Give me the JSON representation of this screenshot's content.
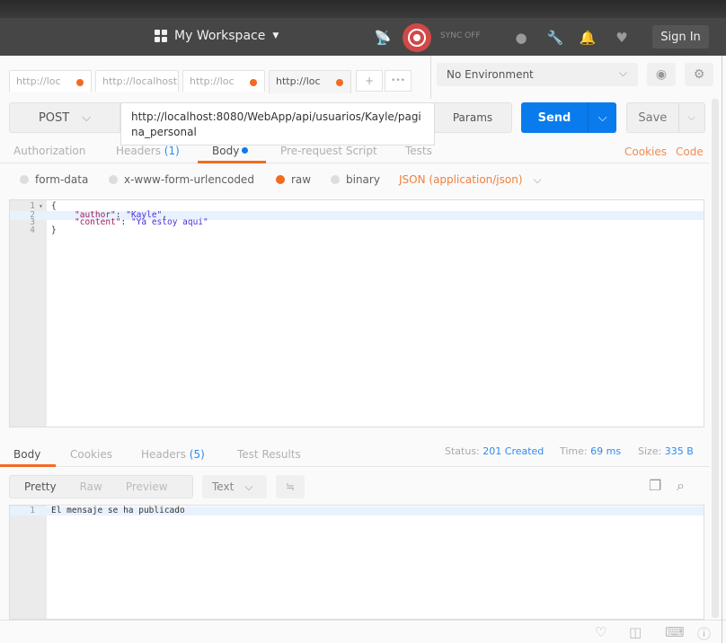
{
  "header": {
    "workspace_label": "My Workspace",
    "sync_status": "SYNC OFF",
    "sign_in_label": "Sign In",
    "icons": [
      "interceptor-icon",
      "sync-icon",
      "globe-icon",
      "wrench-icon",
      "bell-icon",
      "heart-icon"
    ]
  },
  "request_tabs": [
    {
      "label": "http://loc",
      "unsaved": true
    },
    {
      "label": "http://localhost",
      "unsaved": false
    },
    {
      "label": "http://loc",
      "unsaved": true
    },
    {
      "label": "http://loc",
      "unsaved": true,
      "active": true
    }
  ],
  "tab_actions": {
    "new_tab": "+",
    "more": "•••"
  },
  "environment": {
    "selected": "No Environment"
  },
  "request": {
    "method": "POST",
    "url": "http://localhost:8080/WebApp/api/usuarios/Kayle/pagina_personal",
    "url_line1": "http://localhost:8080/WebApp/api/usuarios/Kayle/pagi",
    "url_line2": "na_personal",
    "params_label": "Params",
    "send_label": "Send",
    "save_label": "Save"
  },
  "request_subtabs": {
    "authorization": "Authorization",
    "headers": "Headers",
    "headers_count": "(1)",
    "body": "Body",
    "pre_request": "Pre-request Script",
    "tests": "Tests",
    "cookies": "Cookies",
    "code": "Code",
    "active": "Body"
  },
  "body_options": {
    "form_data": "form-data",
    "urlencoded": "x-www-form-urlencoded",
    "raw": "raw",
    "binary": "binary",
    "selected": "raw",
    "content_type": "JSON (application/json)"
  },
  "request_body": {
    "lines": [
      {
        "num": "1",
        "text": "{"
      },
      {
        "num": "2",
        "key": "\"author\"",
        "value": "\"Kayle\"",
        "suffix": ","
      },
      {
        "num": "3",
        "key": "\"content\"",
        "value": "\"Ya estoy aqui\"",
        "suffix": ""
      },
      {
        "num": "4",
        "text": "}"
      }
    ]
  },
  "response_tabs": {
    "body": "Body",
    "cookies": "Cookies",
    "headers": "Headers",
    "headers_count": "(5)",
    "test_results": "Test Results",
    "active": "Body"
  },
  "response_status": {
    "status_label": "Status:",
    "status_value": "201 Created",
    "time_label": "Time:",
    "time_value": "69 ms",
    "size_label": "Size:",
    "size_value": "335 B"
  },
  "response_view": {
    "pretty": "Pretty",
    "raw": "Raw",
    "preview": "Preview",
    "active": "Pretty",
    "format": "Text"
  },
  "response_body": {
    "lines": [
      {
        "num": "1",
        "text": "El mensaje se ha publicado"
      }
    ]
  }
}
